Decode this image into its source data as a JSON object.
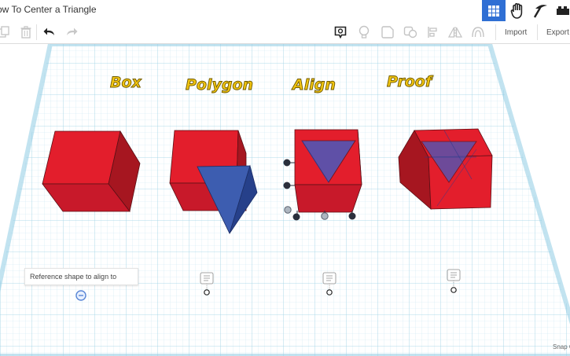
{
  "window": {
    "title": "ow To Center a Triangle"
  },
  "toolbar": {
    "import_label": "Import",
    "export_label": "Export"
  },
  "labels": {
    "box": "Box",
    "polygon": "Polygon",
    "align": "Align",
    "proof": "Proof"
  },
  "callout": {
    "text": "Reference shape to align to"
  },
  "status": {
    "snap": "Snap G"
  },
  "colors": {
    "accent": "#2f6fd4",
    "shape_red": "#e01f2c",
    "shape_blue": "#3a5aa8",
    "label_yellow": "#f1c40f",
    "grid": "#bfe4f0"
  },
  "icons": [
    "grid-view-icon",
    "hand-icon",
    "pickaxe-icon",
    "copy-icon",
    "trash-icon",
    "undo-icon",
    "redo-icon",
    "note-icon",
    "light-icon",
    "shape-icon",
    "solid-hole-icon",
    "align-icon",
    "mirror-icon",
    "group-icon",
    "note-marker-icon"
  ]
}
